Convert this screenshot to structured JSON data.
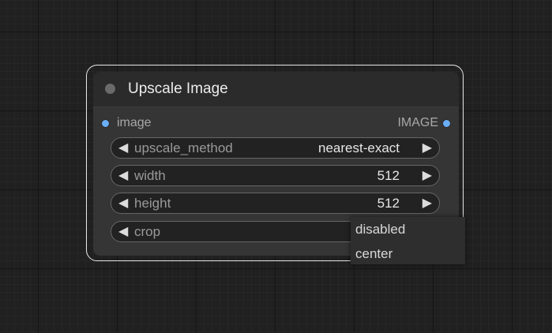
{
  "node": {
    "title": "Upscale Image",
    "input": {
      "label": "image",
      "color": "#6aaef7"
    },
    "output": {
      "label": "IMAGE",
      "color": "#6aaef7"
    },
    "widgets": [
      {
        "label": "upscale_method",
        "value": "nearest-exact"
      },
      {
        "label": "width",
        "value": "512"
      },
      {
        "label": "height",
        "value": "512"
      },
      {
        "label": "crop",
        "value": ""
      }
    ],
    "arrows": {
      "left": "◀",
      "right": "▶"
    }
  },
  "dropdown": {
    "options": [
      "disabled",
      "center"
    ]
  },
  "colors": {
    "canvas_background": "#202020",
    "node_body": "#353535",
    "node_header": "#2b2b2b",
    "selection_outline": "#e8e8e8",
    "widget_background": "#222222"
  }
}
